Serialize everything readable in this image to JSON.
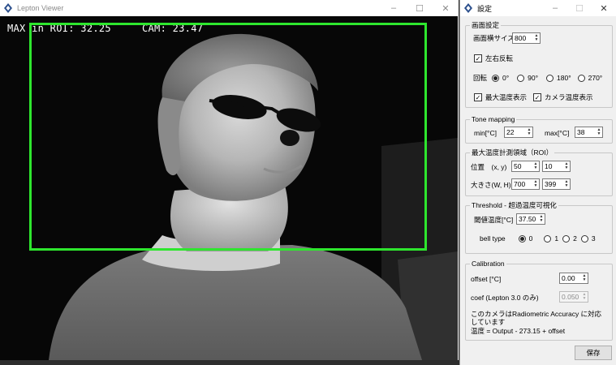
{
  "viewer": {
    "title": "Lepton Viewer",
    "overlay": {
      "max_in_roi": "MAX in ROI: 32.25",
      "cam": "CAM: 23.47"
    },
    "accent": "#2ee62e"
  },
  "settings": {
    "title": "設定",
    "display_group": {
      "title": "画面設定",
      "width_label": "画面横サイズ",
      "width_value": "800",
      "flip_label": "左右反転",
      "rotation_label": "回転",
      "rotation_options": [
        "0°",
        "90°",
        "180°",
        "270°"
      ],
      "show_max_label": "最大温度表示",
      "show_cam_label": "カメラ温度表示"
    },
    "tone_group": {
      "title": "Tone mapping",
      "min_label": "min[°C]",
      "min_value": "22",
      "max_label": "max[°C]",
      "max_value": "38"
    },
    "roi_group": {
      "title": "最大温度計測領域（ROI）",
      "pos_label": "位置　(x, y)",
      "x_value": "50",
      "y_value": "10",
      "size_label": "大きさ(W, H)",
      "w_value": "700",
      "h_value": "399"
    },
    "threshold_group": {
      "title": "Threshold - 超過温度可視化",
      "thresh_label": "閾値温度[°C]",
      "thresh_value": "37.50",
      "bell_label": "bell type",
      "bell_options": [
        "0",
        "1",
        "2",
        "3"
      ]
    },
    "calib_group": {
      "title": "Calibration",
      "offset_label": "offset [°C]",
      "offset_value": "0.00",
      "coef_label": "coef (Lepton 3.0 のみ)",
      "coef_value": "0.050",
      "note_line1": "このカメラはRadiometric Accuracy に対応",
      "note_line2": "しています",
      "note_line3": "温度 = Output - 273.15 + offset"
    },
    "save_label": "保存"
  },
  "icons": {
    "app": "lepton-diamond-icon",
    "minimize": "minimize-icon",
    "maximize": "maximize-icon",
    "close": "close-icon"
  }
}
